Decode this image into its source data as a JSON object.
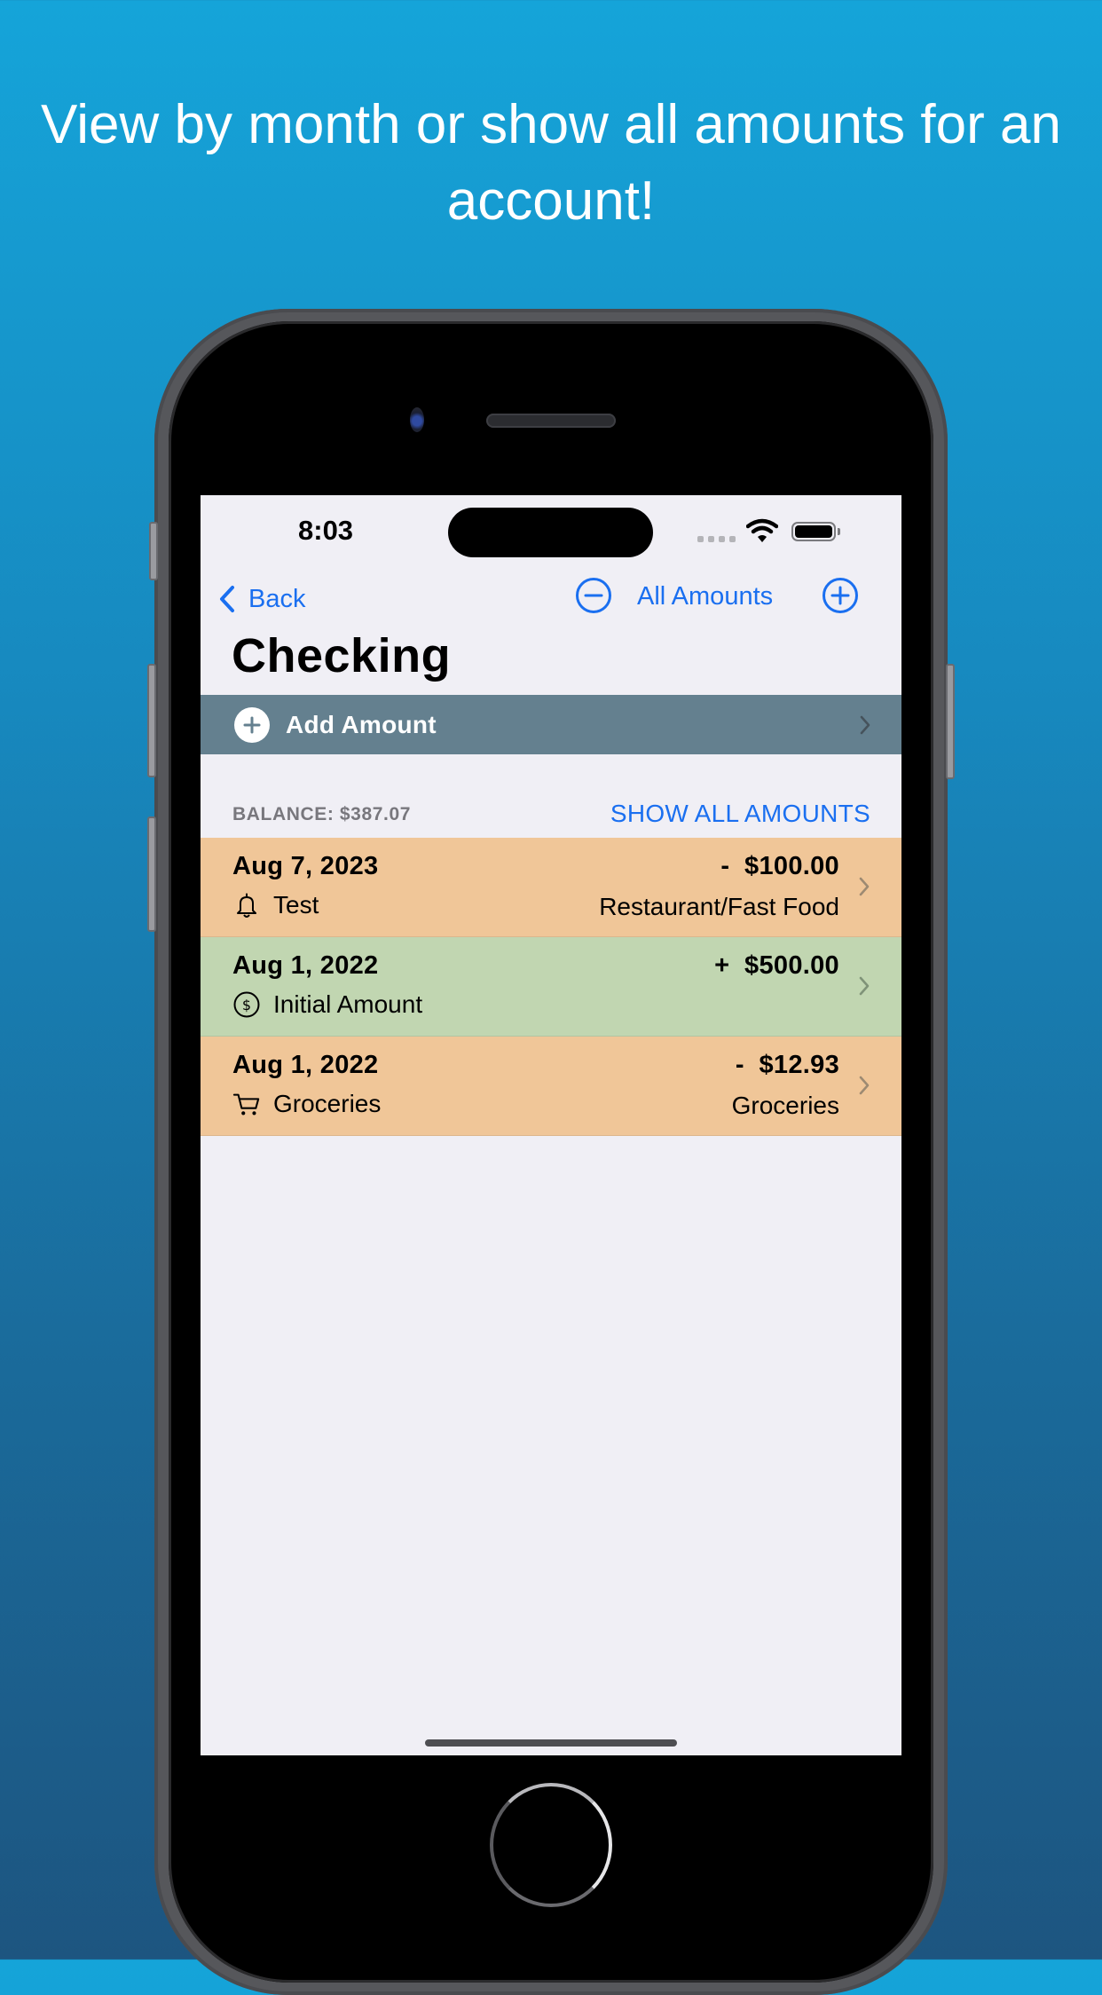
{
  "promo": {
    "headline": "View by month or show all amounts for an account!"
  },
  "status_bar": {
    "time": "8:03",
    "icons": [
      "signal-dots-icon",
      "wifi-icon",
      "battery-icon"
    ]
  },
  "nav": {
    "back_label": "Back",
    "back_icon": "chevron-left-icon",
    "prev_icon": "minus-circle-icon",
    "mode_label": "All Amounts",
    "next_icon": "plus-circle-icon"
  },
  "page": {
    "title": "Checking"
  },
  "add_amount": {
    "label": "Add Amount",
    "icon": "plus-circle-filled-icon"
  },
  "summary": {
    "balance_label": "BALANCE: $387.07",
    "show_all_label": "SHOW ALL AMOUNTS"
  },
  "colors": {
    "accent": "#1a6ff0",
    "add_bar": "#64808f",
    "expense_row": "#f0c698",
    "income_row": "#c1d6b1",
    "screen_bg": "#f0eff5"
  },
  "transactions": [
    {
      "date": "Aug 7, 2023",
      "amount": "-  $100.00",
      "type": "expense",
      "icon": "bell-icon",
      "description": "Test",
      "category": "Restaurant/Fast Food"
    },
    {
      "date": "Aug 1, 2022",
      "amount": "+  $500.00",
      "type": "income",
      "icon": "dollar-circle-icon",
      "description": "Initial Amount",
      "category": ""
    },
    {
      "date": "Aug 1, 2022",
      "amount": "-  $12.93",
      "type": "expense",
      "icon": "cart-icon",
      "description": "Groceries",
      "category": "Groceries"
    }
  ]
}
